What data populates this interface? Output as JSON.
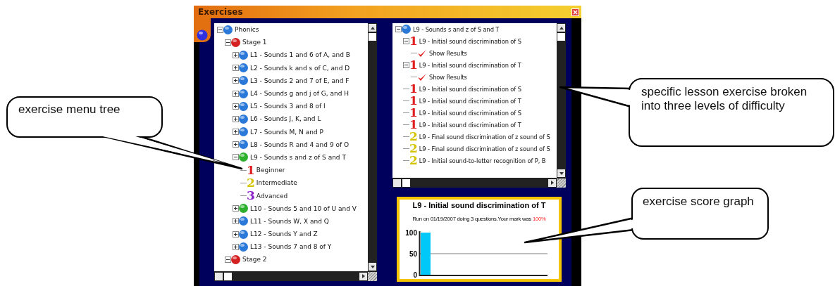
{
  "window": {
    "title": "Exercises"
  },
  "left_tree": {
    "items": [
      {
        "label": "Phonics",
        "kind": "ball",
        "color": "#2a78d8",
        "expanded": true,
        "children": [
          {
            "label": "Stage 1",
            "kind": "ball",
            "color": "#d42020",
            "expanded": true,
            "children": [
              {
                "label": "L1 - Sounds 1 and 6 of A, and B",
                "kind": "ball",
                "color": "#2a78d8",
                "expanded": false
              },
              {
                "label": "L2 - Sounds k and s of C, and D",
                "kind": "ball",
                "color": "#2a78d8",
                "expanded": false
              },
              {
                "label": "L3 - Sounds 2 and 7 of E, and F",
                "kind": "ball",
                "color": "#2a78d8",
                "expanded": false
              },
              {
                "label": "L4 - Sounds g and j of G, and H",
                "kind": "ball",
                "color": "#2a78d8",
                "expanded": false
              },
              {
                "label": "L5 - Sounds 3 and 8 of I",
                "kind": "ball",
                "color": "#2a78d8",
                "expanded": false
              },
              {
                "label": "L6 - Sounds J, K, and L",
                "kind": "ball",
                "color": "#2a78d8",
                "expanded": false
              },
              {
                "label": "L7 - Sounds M, N and P",
                "kind": "ball",
                "color": "#2a78d8",
                "expanded": false
              },
              {
                "label": "L8 - Sounds R and 4 and 9 of O",
                "kind": "ball",
                "color": "#2a78d8",
                "expanded": false
              },
              {
                "label": "L9 - Sounds s and z of S and T",
                "kind": "ball",
                "color": "#2eb02e",
                "expanded": true,
                "children": [
                  {
                    "label": "Beginner",
                    "kind": "level",
                    "numeral": "1",
                    "color": "#e02020"
                  },
                  {
                    "label": "Intermediate",
                    "kind": "level",
                    "numeral": "2",
                    "color": "#d4c400"
                  },
                  {
                    "label": "Advanced",
                    "kind": "level",
                    "numeral": "3",
                    "color": "#8a20c8"
                  }
                ]
              },
              {
                "label": "L10 - Sounds 5 and 10 of U and V",
                "kind": "ball",
                "color": "#2eb02e",
                "expanded": false
              },
              {
                "label": "L11 - Sounds W, X and Q",
                "kind": "ball",
                "color": "#2a78d8",
                "expanded": false
              },
              {
                "label": "L12 - Sounds Y and Z",
                "kind": "ball",
                "color": "#2a78d8",
                "expanded": false
              },
              {
                "label": "L13 - Sounds 7 and 8 of Y",
                "kind": "ball",
                "color": "#2a78d8",
                "expanded": false
              }
            ]
          },
          {
            "label": "Stage 2",
            "kind": "ball",
            "color": "#d42020",
            "expanded": true
          }
        ]
      }
    ]
  },
  "right_tree": {
    "items": [
      {
        "label": "L9 - Sounds s and z of S and T",
        "kind": "ball",
        "color": "#2a78d8",
        "expanded": true,
        "children": [
          {
            "label": "L9 - Initial sound discrimination of S",
            "kind": "level",
            "numeral": "1",
            "color": "#e02020",
            "expanded": true,
            "children": [
              {
                "label": "Show Results",
                "kind": "check"
              }
            ]
          },
          {
            "label": "L9 - Initial sound discrimination of T",
            "kind": "level",
            "numeral": "1",
            "color": "#e02020",
            "expanded": true,
            "children": [
              {
                "label": "Show Results",
                "kind": "check"
              }
            ]
          },
          {
            "label": "L9 - Initial sound discrimination of S",
            "kind": "level",
            "numeral": "1",
            "color": "#e02020"
          },
          {
            "label": "L9 - Initial sound discrimination of T",
            "kind": "level",
            "numeral": "1",
            "color": "#e02020"
          },
          {
            "label": "L9 - Initial sound discrimination of S",
            "kind": "level",
            "numeral": "1",
            "color": "#e02020"
          },
          {
            "label": "L9 - Initial sound discrimination of T",
            "kind": "level",
            "numeral": "1",
            "color": "#e02020"
          },
          {
            "label": "L9 - Final sound discrimination of z sound of S",
            "kind": "level",
            "numeral": "2",
            "color": "#d4c400"
          },
          {
            "label": "L9 - Final sound discrimination of z sound of S",
            "kind": "level",
            "numeral": "2",
            "color": "#d4c400"
          },
          {
            "label": "L9 - Initial sound-to-letter recognition of P, B",
            "kind": "level",
            "numeral": "2",
            "color": "#d4c400"
          }
        ]
      }
    ]
  },
  "score_panel": {
    "title": "L9 - Initial sound discrimination of T",
    "summary": "Run on 01/19/2007 doing 3 questions.Your mark was",
    "mark": "100%",
    "chart_data": {
      "type": "bar",
      "values": [
        100
      ],
      "ylim": [
        0,
        100
      ],
      "yticks": [
        0,
        50,
        100
      ]
    }
  },
  "callouts": [
    {
      "text": "exercise menu tree"
    },
    {
      "text": "specific lesson exercise broken into three levels of difficulty"
    },
    {
      "text": "exercise score graph"
    }
  ]
}
